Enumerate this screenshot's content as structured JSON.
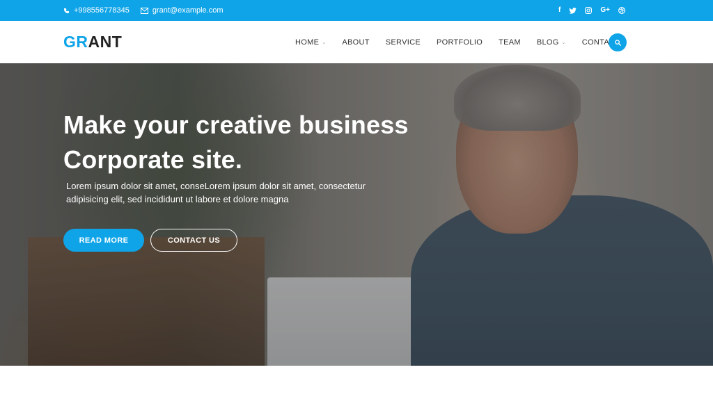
{
  "topbar": {
    "phone": "+998556778345",
    "email": "grant@example.com",
    "social": [
      {
        "icon": "facebook-icon",
        "glyph": "f"
      },
      {
        "icon": "twitter-icon",
        "glyph": "🐦"
      },
      {
        "icon": "instagram-icon",
        "glyph": "◎"
      },
      {
        "icon": "google-plus-icon",
        "glyph": "G+"
      },
      {
        "icon": "dribbble-icon",
        "glyph": "⊛"
      }
    ]
  },
  "logo": {
    "part_a": "GR",
    "part_b": "ANT"
  },
  "nav": {
    "items": [
      {
        "label": "HOME",
        "dropdown": true
      },
      {
        "label": "ABOUT",
        "dropdown": false
      },
      {
        "label": "SERVICE",
        "dropdown": false
      },
      {
        "label": "PORTFOLIO",
        "dropdown": false
      },
      {
        "label": "TEAM",
        "dropdown": false
      },
      {
        "label": "BLOG",
        "dropdown": true
      },
      {
        "label": "CONTACT",
        "dropdown": false
      }
    ],
    "search_icon": "search-icon"
  },
  "hero": {
    "title_line1": "Make your creative business",
    "title_line2": "Corporate site.",
    "text_line1": "Lorem ipsum dolor sit amet, conseLorem ipsum dolor sit amet, consectetur",
    "text_line2": "adipisicing elit, sed incididunt ut labore et dolore magna",
    "primary_button": "READ MORE",
    "secondary_button": "CONTACT US"
  },
  "colors": {
    "accent": "#0fa4e8",
    "logo_dark": "#222222",
    "nav_text": "#333333"
  }
}
